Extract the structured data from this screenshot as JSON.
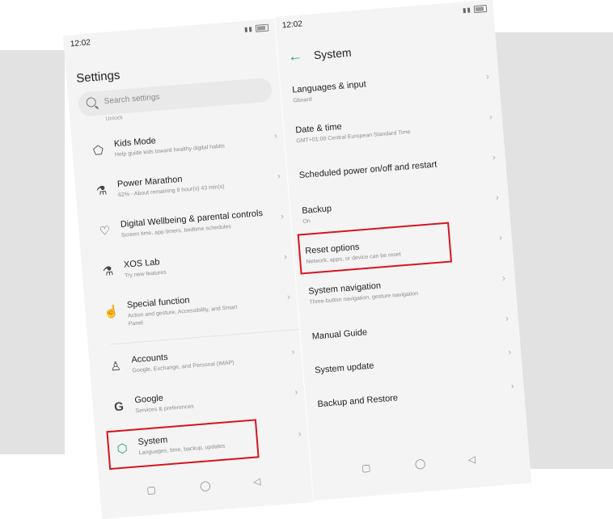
{
  "left": {
    "time": "12:02",
    "title": "Settings",
    "search_placeholder": "Search settings",
    "cut_text": "Unlock",
    "items": [
      {
        "title": "Kids Mode",
        "subtitle": "Help guide kids toward healthy digital habits",
        "icon": "kids-mode-icon",
        "glyph": "⬠"
      },
      {
        "title": "Power Marathon",
        "subtitle": "62% - About remaining 9 hour(s) 43 min(s)",
        "icon": "power-marathon-icon",
        "glyph": "⚗"
      },
      {
        "title": "Digital Wellbeing & parental controls",
        "subtitle": "Screen time, app timers, bedtime schedules",
        "icon": "digital-wellbeing-icon",
        "glyph": "♡"
      },
      {
        "title": "XOS Lab",
        "subtitle": "Try new features",
        "icon": "xos-lab-icon",
        "glyph": "⚗"
      },
      {
        "title": "Special function",
        "subtitle": "Action and gesture, Accessibility, and Smart",
        "subtitle2": "Panel",
        "icon": "special-function-icon",
        "glyph": "☝"
      },
      {
        "title": "Accounts",
        "subtitle": "Google, Exchange, and Personal (IMAP)",
        "icon": "accounts-icon",
        "glyph": "♙"
      },
      {
        "title": "Google",
        "subtitle": "Services & preferences",
        "icon": "google-icon",
        "glyph": "G"
      },
      {
        "title": "System",
        "subtitle": "Languages, time, backup, updates",
        "icon": "system-icon",
        "glyph": "⬡"
      }
    ]
  },
  "right": {
    "time": "12:02",
    "title": "System",
    "items": [
      {
        "title": "Languages & input",
        "subtitle": "Gboard"
      },
      {
        "title": "Date & time",
        "subtitle": "GMT+01:00 Central European Standard Time"
      },
      {
        "title": "Scheduled power on/off and restart",
        "subtitle": ""
      },
      {
        "title": "Backup",
        "subtitle": "On"
      },
      {
        "title": "Reset options",
        "subtitle": "Network, apps, or device can be reset"
      },
      {
        "title": "System navigation",
        "subtitle": "Three-button navigation, gesture navigation"
      },
      {
        "title": "Manual Guide",
        "subtitle": ""
      },
      {
        "title": "System update",
        "subtitle": ""
      },
      {
        "title": "Backup and Restore",
        "subtitle": ""
      }
    ]
  },
  "nav": {
    "recents": "▢",
    "home": "◯",
    "back": "◁"
  },
  "colors": {
    "highlight": "#d6141e",
    "accent": "#12a36f"
  }
}
